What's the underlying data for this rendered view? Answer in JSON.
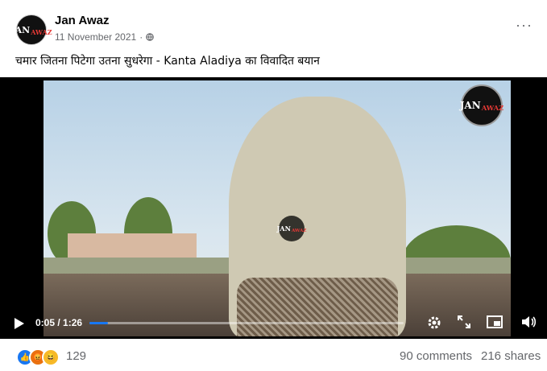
{
  "post": {
    "page_name": "Jan Awaz",
    "date": "11 November 2021",
    "separator": "·",
    "caption": "चमार जितना पिटेगा उतना सुधरेगा - Kanta Aladiya का विवादित बयान",
    "more_icon": "more-options-icon",
    "privacy_icon": "globe-icon"
  },
  "avatar": {
    "text": "JAN",
    "accent": "AWAZ"
  },
  "video": {
    "watermark_text": "JAN",
    "watermark_accent": "AWAZ",
    "current_time": "0:05",
    "duration": "1:26",
    "time_sep": " / ",
    "progress": 0.058,
    "progress_color": "#1877f2",
    "icons": [
      "play-icon",
      "settings-icon",
      "expand-icon",
      "picture-in-picture-icon",
      "volume-icon"
    ]
  },
  "footer": {
    "reaction_count": "129",
    "comments": "90 comments",
    "shares": "216 shares",
    "reactions": [
      "like",
      "angry",
      "haha"
    ],
    "colors": {
      "like": "#1877f2",
      "angry": "#e9710f",
      "haha": "#f7b928"
    }
  }
}
